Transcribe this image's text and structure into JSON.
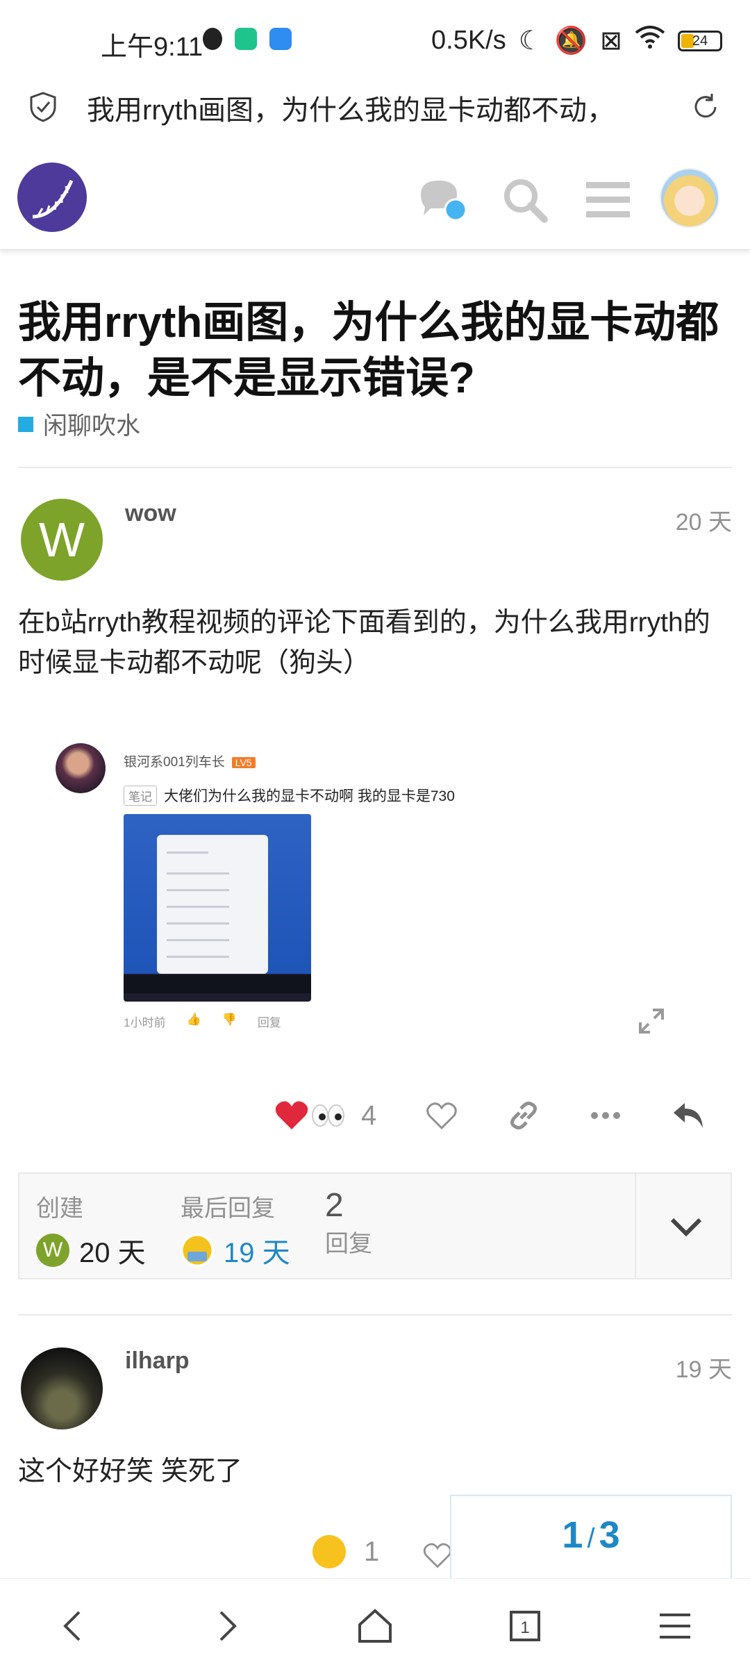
{
  "status_bar": {
    "time": "上午9:11",
    "net_speed": "0.5K/s",
    "battery": "24"
  },
  "url_bar": {
    "title": "我用rryth画图，为什么我的显卡动都不动，"
  },
  "topic": {
    "title": "我用rryth画图，为什么我的显卡动都不动，是不是显示错误?",
    "category": "闲聊吹水",
    "category_color": "#25aae1"
  },
  "first_post": {
    "avatar_letter": "W",
    "username": "wow",
    "date": "20 天",
    "body": "在b站rryth教程视频的评论下面看到的，为什么我用rryth的时候显卡动都不动呢（狗头）",
    "embed": {
      "commenter": "银河系001列车长",
      "badge": "LV5",
      "note_tag": "笔记",
      "comment_text": "大佬们为什么我的显卡不动啊   我的显卡是730",
      "time_ago": "1小时前",
      "reply_label": "回复"
    },
    "reaction_count": "4"
  },
  "topic_map": {
    "created_label": "创建",
    "created_avatar_letter": "W",
    "created_value": "20 天",
    "last_reply_label": "最后回复",
    "last_reply_value": "19 天",
    "replies_count": "2",
    "replies_label": "回复"
  },
  "second_post": {
    "username": "ilharp",
    "date": "19 天",
    "body": "这个好好笑 笑死了",
    "reaction_count": "1"
  },
  "timeline": {
    "current": "1",
    "separator": "/",
    "total": "3"
  },
  "colors": {
    "accent": "#1e88c7",
    "heart": "#e0283c",
    "logo_bg": "#4e3a9a"
  }
}
